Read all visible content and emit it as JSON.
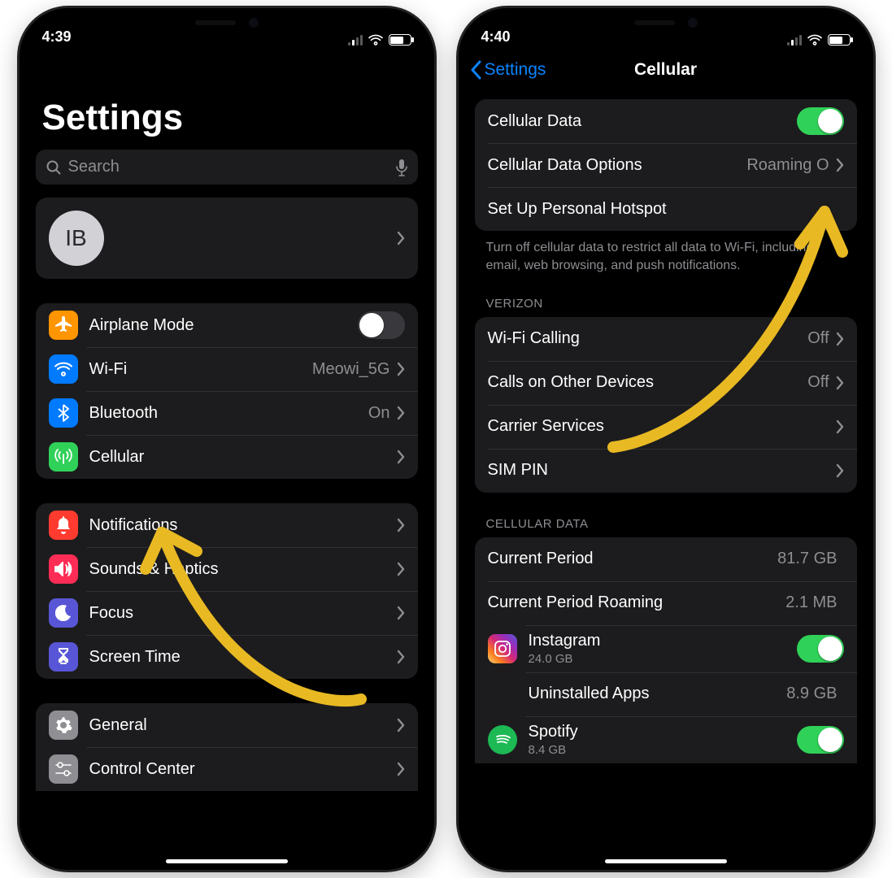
{
  "phone1": {
    "status_time": "4:39",
    "title": "Settings",
    "search_placeholder": "Search",
    "profile_initials": "IB",
    "network": {
      "airplane": "Airplane Mode",
      "wifi": {
        "label": "Wi-Fi",
        "value": "Meowi_5G"
      },
      "bluetooth": {
        "label": "Bluetooth",
        "value": "On"
      },
      "cellular": "Cellular"
    },
    "section2": {
      "notifications": "Notifications",
      "sounds": "Sounds & Haptics",
      "focus": "Focus",
      "screentime": "Screen Time"
    },
    "section3": {
      "general": "General",
      "controlcenter": "Control Center"
    }
  },
  "phone2": {
    "status_time": "4:40",
    "back_label": "Settings",
    "title": "Cellular",
    "top": {
      "cellular_data": "Cellular Data",
      "options": {
        "label": "Cellular Data Options",
        "value": "Roaming O"
      },
      "hotspot": "Set Up Personal Hotspot"
    },
    "footer_note": "Turn off cellular data to restrict all data to Wi-Fi, including email, web browsing, and push notifications.",
    "carrier_header": "VERIZON",
    "carrier": {
      "wifi_calling": {
        "label": "Wi-Fi Calling",
        "value": "Off"
      },
      "calls_other": {
        "label": "Calls on Other Devices",
        "value": "Off"
      },
      "carrier_services": "Carrier Services",
      "sim_pin": "SIM PIN"
    },
    "data_header": "CELLULAR DATA",
    "data": {
      "current": {
        "label": "Current Period",
        "value": "81.7 GB"
      },
      "roaming": {
        "label": "Current Period Roaming",
        "value": "2.1 MB"
      },
      "instagram": {
        "label": "Instagram",
        "value": "24.0 GB"
      },
      "uninstalled": {
        "label": "Uninstalled Apps",
        "value": "8.9 GB"
      },
      "spotify": {
        "label": "Spotify",
        "value": "8.4 GB"
      }
    }
  }
}
